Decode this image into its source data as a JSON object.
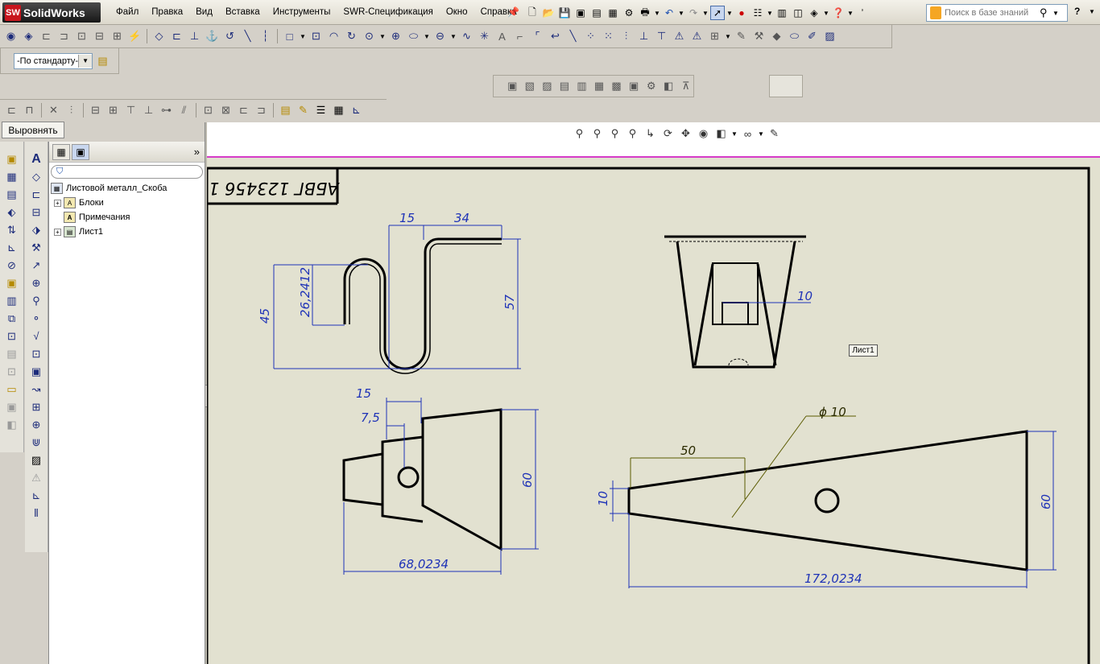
{
  "app": {
    "logo_badge": "SW",
    "logo_name": "SolidWorks"
  },
  "menu": [
    "Файл",
    "Правка",
    "Вид",
    "Вставка",
    "Инструменты",
    "SWR-Спецификация",
    "Окно",
    "Справка"
  ],
  "search": {
    "placeholder": "Поиск в базе знаний"
  },
  "help_label": "?",
  "layer": {
    "value": "-По стандарту-"
  },
  "align_tab": "Выровнять",
  "feature_tree": {
    "root": "Листовой металл_Скоба",
    "items": [
      "Блоки",
      "Примечания",
      "Лист1"
    ]
  },
  "drawing": {
    "title_text": "АБВГ 123456 1",
    "sheet_label": "Лист1",
    "dims": {
      "top_15": "15",
      "top_34": "34",
      "d_26": "26,2412",
      "d_45": "45",
      "d_57": "57",
      "d_10_top": "10",
      "bl_15": "15",
      "bl_75": "7,5",
      "bl_60": "60",
      "bl_68": "68,0234",
      "br_phi": "ϕ 10",
      "br_50": "50",
      "br_10": "10",
      "br_60": "60",
      "br_172": "172,0234"
    }
  },
  "colors": {
    "sheet_bg": "#e2e1d0",
    "dimension": "#1f33b7",
    "sheet_border": "#d63cc8"
  }
}
